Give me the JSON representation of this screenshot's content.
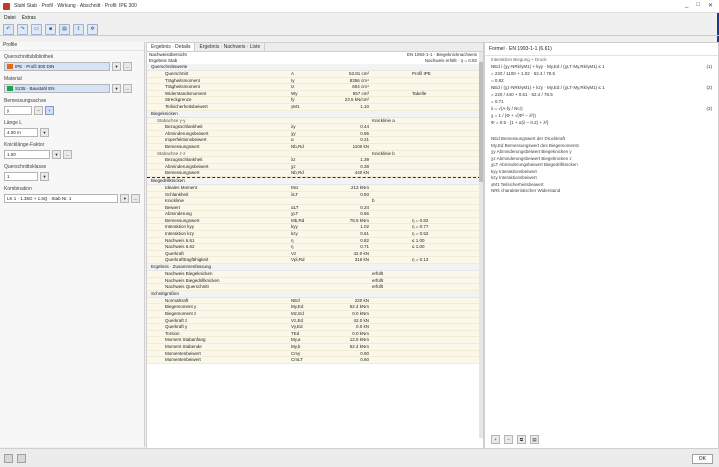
{
  "window": {
    "title": "Stahl Stab · Profil · Wirkung · Abschnitt · Profil: IPE 300",
    "minimize": "_",
    "maximize": "□",
    "close": "✕"
  },
  "menubar": {
    "items": [
      "Datei",
      "Extras"
    ]
  },
  "toolbar": {
    "buttons": [
      "undo",
      "redo",
      "open",
      "save",
      "print",
      "export",
      "settings"
    ]
  },
  "left_panel": {
    "header": "Profile",
    "groups": [
      {
        "label": "Querschnittsbibliothek",
        "value": "IPE · Profil 300 DIN",
        "swatch": "#e06b1a"
      },
      {
        "label": "Material",
        "value": "S235 · Baustahl EN",
        "swatch": "#1aa34a"
      },
      {
        "label": "Bemessungsachse",
        "value": "y",
        "buttons": [
          "−",
          "+"
        ]
      },
      {
        "label": "Länge L",
        "value": "4.00 m"
      },
      {
        "label": "Knicklänge-Faktor",
        "value": "1.00"
      },
      {
        "label": "Querschnittsklasse",
        "value": "1"
      },
      {
        "label": "Kombination",
        "value": "LK 1 · 1.35G + 1.5Q · Stab Nr. 1"
      }
    ]
  },
  "center_panel": {
    "tabs": [
      "Ergebnis · Details",
      "Ergebnis · Nachweis · Liste"
    ],
    "header_left": [
      "Nachweisübersicht",
      "Ergebnis Stab"
    ],
    "header_right": [
      "EN 1993-1-1 · Biegeknicknachweis",
      "Nachweis erfüllt · η = 0.82"
    ],
    "sections": [
      {
        "title": "Querschnittswerte",
        "rows": [
          {
            "c1": "Querschnitt",
            "c2": "A",
            "c3": "53.81 cm²",
            "c4": "",
            "c5": "Profil IPE"
          },
          {
            "c1": "Trägheitsmoment",
            "c2": "Iy",
            "c3": "8356 cm⁴",
            "c4": "",
            "c5": ""
          },
          {
            "c1": "Trägheitsmoment",
            "c2": "Iz",
            "c3": "604 cm⁴",
            "c4": "",
            "c5": ""
          },
          {
            "c1": "Widerstandsmoment",
            "c2": "Wy",
            "c3": "557 cm³",
            "c4": "",
            "c5": "Tabelle"
          },
          {
            "c1": "Streckgrenze",
            "c2": "fy",
            "c3": "23.5 kN/cm²",
            "c4": "",
            "c5": ""
          },
          {
            "c1": "Teilsicherheitsbeiwert",
            "c2": "γM1",
            "c3": "1.10",
            "c4": "",
            "c5": ""
          }
        ]
      },
      {
        "title": "Biegeknicken",
        "rows": [
          {
            "c1": "Stabachse y-y",
            "c2": "",
            "c3": "",
            "c4": "Knicklinie a",
            "c5": "",
            "sub": true
          },
          {
            "c1": "Bezugsschlankheit",
            "c2": "λy",
            "c3": "0.44",
            "c4": "",
            "c5": ""
          },
          {
            "c1": "Abminderungsbeiwert",
            "c2": "χy",
            "c3": "0.95",
            "c4": "",
            "c5": ""
          },
          {
            "c1": "Imperfektionsbeiwert",
            "c2": "α",
            "c3": "0.21",
            "c4": "",
            "c5": ""
          },
          {
            "c1": "Bemessungswert",
            "c2": "Nb,Rd",
            "c3": "1100 kN",
            "c4": "",
            "c5": ""
          },
          {
            "c1": "Stabachse z-z",
            "c2": "",
            "c3": "",
            "c4": "Knicklinie b",
            "c5": "",
            "sub": true
          },
          {
            "c1": "Bezugsschlankheit",
            "c2": "λz",
            "c3": "1.39",
            "c4": "",
            "c5": ""
          },
          {
            "c1": "Abminderungsbeiwert",
            "c2": "χz",
            "c3": "0.38",
            "c4": "",
            "c5": ""
          },
          {
            "c1": "Bemessungswert",
            "c2": "Nb,Rd",
            "c3": "440 kN",
            "c4": "",
            "c5": ""
          }
        ]
      },
      {
        "title": "Biegedrillknicken",
        "focused": true,
        "rows": [
          {
            "c1": "Ideales Moment",
            "c2": "Mcr",
            "c3": "213 kNm",
            "c4": "",
            "c5": ""
          },
          {
            "c1": "Schlankheit",
            "c2": "λLT",
            "c3": "0.93",
            "c4": "",
            "c5": ""
          },
          {
            "c1": "Knicklinie",
            "c2": "",
            "c3": "",
            "c4": "b",
            "c5": ""
          },
          {
            "c1": "Beiwert",
            "c2": "αLT",
            "c3": "0.34",
            "c4": "",
            "c5": ""
          },
          {
            "c1": "Abminderung",
            "c2": "χLT",
            "c3": "0.66",
            "c4": "",
            "c5": ""
          },
          {
            "c1": "Bemessungswert",
            "c2": "Mb,Rd",
            "c3": "78.5 kNm",
            "c4": "",
            "c5": "η = 0.82"
          },
          {
            "c1": "Interaktion kyy",
            "c2": "kyy",
            "c3": "1.02",
            "c4": "",
            "c5": "η = 0.77"
          },
          {
            "c1": "Interaktion kzy",
            "c2": "kzy",
            "c3": "0.61",
            "c4": "",
            "c5": "η = 0.52"
          },
          {
            "c1": "Nachweis 6.61",
            "c2": "η",
            "c3": "0.82",
            "c4": "",
            "c5": "≤ 1.00"
          },
          {
            "c1": "Nachweis 6.62",
            "c2": "η",
            "c3": "0.71",
            "c4": "",
            "c5": "≤ 1.00"
          },
          {
            "c1": "Querkraft",
            "c2": "Vz",
            "c3": "42.0 kN",
            "c4": "",
            "c5": ""
          },
          {
            "c1": "Querkrafttragfähigkeit",
            "c2": "Vpl,Rd",
            "c3": "316 kN",
            "c4": "",
            "c5": "η = 0.13"
          }
        ]
      },
      {
        "title": "Ergebnis · Zusammenfassung",
        "rows": [
          {
            "c1": "Nachweis Biegeknicken",
            "c2": "",
            "c3": "",
            "c4": "erfüllt",
            "c5": ""
          },
          {
            "c1": "Nachweis Biegedrillknicken",
            "c2": "",
            "c3": "",
            "c4": "erfüllt",
            "c5": ""
          },
          {
            "c1": "Nachweis Querschnitt",
            "c2": "",
            "c3": "",
            "c4": "erfüllt",
            "c5": ""
          }
        ]
      },
      {
        "title": "Schnittgrößen",
        "rows": [
          {
            "c1": "Normalkraft",
            "c2": "NEd",
            "c3": "220 kN",
            "c4": "",
            "c5": ""
          },
          {
            "c1": "Biegemoment y",
            "c2": "My,Ed",
            "c3": "52.4 kNm",
            "c4": "",
            "c5": ""
          },
          {
            "c1": "Biegemoment z",
            "c2": "Mz,Ed",
            "c3": "0.0 kNm",
            "c4": "",
            "c5": ""
          },
          {
            "c1": "Querkraft z",
            "c2": "Vz,Ed",
            "c3": "42.0 kN",
            "c4": "",
            "c5": ""
          },
          {
            "c1": "Querkraft y",
            "c2": "Vy,Ed",
            "c3": "0.0 kN",
            "c4": "",
            "c5": ""
          },
          {
            "c1": "Torsion",
            "c2": "TEd",
            "c3": "0.0 kNm",
            "c4": "",
            "c5": ""
          },
          {
            "c1": "Moment Stabanfang",
            "c2": "My,a",
            "c3": "12.5 kNm",
            "c4": "",
            "c5": ""
          },
          {
            "c1": "Moment Stabende",
            "c2": "My,b",
            "c3": "52.4 kNm",
            "c4": "",
            "c5": ""
          },
          {
            "c1": "Momentenbeiwert",
            "c2": "Cmy",
            "c3": "0.90",
            "c4": "",
            "c5": ""
          },
          {
            "c1": "Momentenbeiwert",
            "c2": "CmLT",
            "c3": "0.60",
            "c4": "",
            "c5": ""
          }
        ]
      }
    ]
  },
  "right_panel": {
    "title": "Formel · EN 1993-1-1 (6.61)",
    "subtitle": "Interaktion Biegung + Druck",
    "formula_lines": [
      {
        "text": "NEd / (χy·NRk/γM1) + kyy · My,Ed / (χLT·My,Rk/γM1) ≤ 1",
        "num": "(1)"
      },
      {
        "text": "= 220 / 1100 + 1.02 · 52.4 / 78.5",
        "num": ""
      },
      {
        "text": "= 0.82",
        "num": ""
      },
      {
        "text": "NEd / (χz·NRk/γM1) + kzy · My,Ed / (χLT·My,Rk/γM1) ≤ 1",
        "num": "(2)"
      },
      {
        "text": "= 220 / 440 + 0.61 · 52.4 / 78.5",
        "num": ""
      },
      {
        "text": "= 0.71",
        "num": ""
      },
      {
        "text": "λ = √(A·fy / Ncr)",
        "num": "(3)"
      },
      {
        "text": "χ = 1 / (Φ + √(Φ² − λ²))",
        "num": ""
      },
      {
        "text": "Φ = 0.5 · [1 + α(λ − 0.2) + λ²]",
        "num": ""
      }
    ],
    "references": [
      "NEd   Bemessungswert der Druckkraft",
      "My,Ed   Bemessungswert des Biegemoments",
      "χy   Abminderungsbeiwert Biegeknicken y",
      "χz   Abminderungsbeiwert Biegeknicken z",
      "χLT   Abminderungsbeiwert Biegedrillknicken",
      "kyy   Interaktionsbeiwert",
      "kzy   Interaktionsbeiwert",
      "γM1   Teilsicherheitsbeiwert",
      "NRk   charakteristischer Widerstand"
    ],
    "toolbar": [
      "zoom-in",
      "zoom-out",
      "copy",
      "print"
    ]
  },
  "statusbar": {
    "close_label": "OK"
  }
}
